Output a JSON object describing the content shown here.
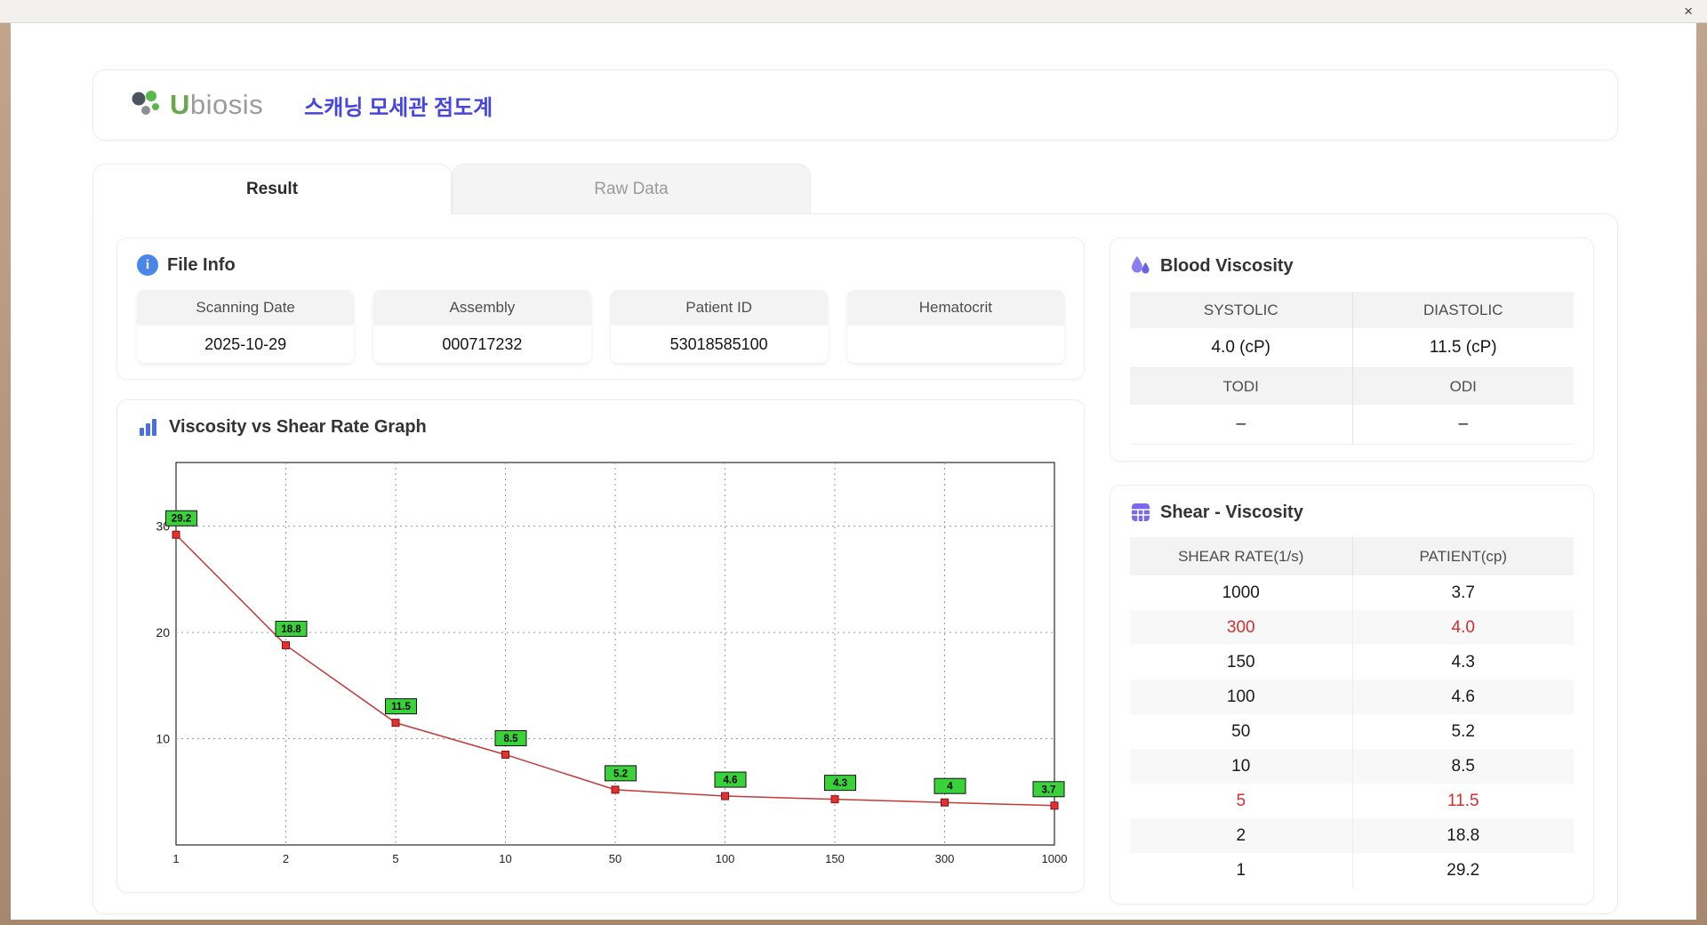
{
  "window": {
    "close_label": "×"
  },
  "header": {
    "logo_u": "U",
    "logo_rest": "biosis",
    "title": "스캐닝 모세관 점도계"
  },
  "tabs": [
    {
      "label": "Result",
      "active": true
    },
    {
      "label": "Raw Data",
      "active": false
    }
  ],
  "file_info": {
    "title": "File Info",
    "fields": [
      {
        "label": "Scanning Date",
        "value": "2025-10-29"
      },
      {
        "label": "Assembly",
        "value": "000717232"
      },
      {
        "label": "Patient ID",
        "value": "53018585100"
      },
      {
        "label": "Hematocrit",
        "value": ""
      }
    ]
  },
  "graph": {
    "title": "Viscosity vs Shear Rate Graph"
  },
  "blood_viscosity": {
    "title": "Blood Viscosity",
    "cells": [
      {
        "label": "SYSTOLIC",
        "value": "4.0 (cP)"
      },
      {
        "label": "DIASTOLIC",
        "value": "11.5 (cP)"
      },
      {
        "label": "TODI",
        "value": "–"
      },
      {
        "label": "ODI",
        "value": "–"
      }
    ]
  },
  "shear_viscosity": {
    "title": "Shear - Viscosity",
    "columns": [
      "SHEAR RATE(1/s)",
      "PATIENT(cp)"
    ],
    "rows": [
      {
        "shear": "1000",
        "patient": "3.7",
        "highlight": false
      },
      {
        "shear": "300",
        "patient": "4.0",
        "highlight": true
      },
      {
        "shear": "150",
        "patient": "4.3",
        "highlight": false
      },
      {
        "shear": "100",
        "patient": "4.6",
        "highlight": false
      },
      {
        "shear": "50",
        "patient": "5.2",
        "highlight": false
      },
      {
        "shear": "10",
        "patient": "8.5",
        "highlight": false
      },
      {
        "shear": "5",
        "patient": "11.5",
        "highlight": true
      },
      {
        "shear": "2",
        "patient": "18.8",
        "highlight": false
      },
      {
        "shear": "1",
        "patient": "29.2",
        "highlight": false
      }
    ]
  },
  "chart_data": {
    "type": "line",
    "title": "Viscosity vs Shear Rate Graph",
    "x": [
      1,
      2,
      5,
      10,
      50,
      100,
      150,
      300,
      1000
    ],
    "x_scale": "category",
    "values": [
      29.2,
      18.8,
      11.5,
      8.5,
      5.2,
      4.6,
      4.3,
      4.0,
      3.7
    ],
    "point_labels": [
      "29.2",
      "18.8",
      "11.5",
      "8.5",
      "5.2",
      "4.6",
      "4.3",
      "4",
      "3.7"
    ],
    "x_ticks": [
      "1",
      "2",
      "5",
      "10",
      "50",
      "100",
      "150",
      "300",
      "1000"
    ],
    "y_ticks": [
      10,
      20,
      30
    ],
    "ylim": [
      0,
      36
    ],
    "grid": "dotted",
    "legend": "none",
    "line_color": "#c23a3a",
    "marker_color": "#e03131",
    "marker_stroke": "#8b1010",
    "label_bg": "#3ad23a",
    "label_border": "#111111"
  }
}
